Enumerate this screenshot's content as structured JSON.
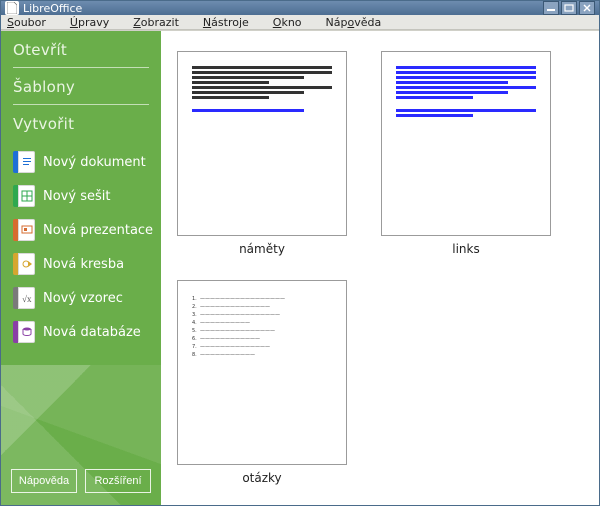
{
  "titlebar": {
    "title": "LibreOffice"
  },
  "menubar": {
    "items": [
      "Soubor",
      "Úpravy",
      "Zobrazit",
      "Nástroje",
      "Okno",
      "Nápověda"
    ]
  },
  "sidebar": {
    "open_label": "Otevřít",
    "templates_label": "Šablony",
    "create_label": "Vytvořit",
    "create_items": [
      {
        "icon": "writer",
        "label": "Nový dokument"
      },
      {
        "icon": "calc",
        "label": "Nový sešit"
      },
      {
        "icon": "impress",
        "label": "Nová prezentace"
      },
      {
        "icon": "draw",
        "label": "Nová kresba"
      },
      {
        "icon": "math",
        "label": "Nový vzorec"
      },
      {
        "icon": "base",
        "label": "Nová databáze"
      }
    ],
    "help_button": "Nápověda",
    "extensions_button": "Rozšíření"
  },
  "recent_docs": [
    {
      "name": "náměty",
      "kind": "text"
    },
    {
      "name": "links",
      "kind": "links"
    },
    {
      "name": "otázky",
      "kind": "list"
    }
  ]
}
